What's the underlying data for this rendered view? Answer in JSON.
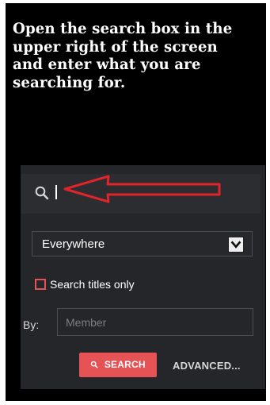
{
  "instruction": {
    "text": "Open the search box in the\nupper right of the screen\nand enter what you are\nsearching for."
  },
  "search_panel": {
    "search_query": "",
    "search_icon": "search-icon",
    "location_dropdown": {
      "selected_value": "Everywhere",
      "icon": "chevron-down-icon"
    },
    "checkbox": {
      "label": "Search titles only",
      "checked": false
    },
    "by_field": {
      "label": "By:",
      "placeholder": "Member",
      "value": ""
    },
    "buttons": {
      "search_label": "SEARCH",
      "advanced_label": "ADVANCED..."
    }
  },
  "colors": {
    "background": "#000000",
    "panel": "#252629",
    "accent": "#e65355",
    "arrow": "#e0242a",
    "text": "#ffffff",
    "muted_text": "#7b7e83"
  }
}
